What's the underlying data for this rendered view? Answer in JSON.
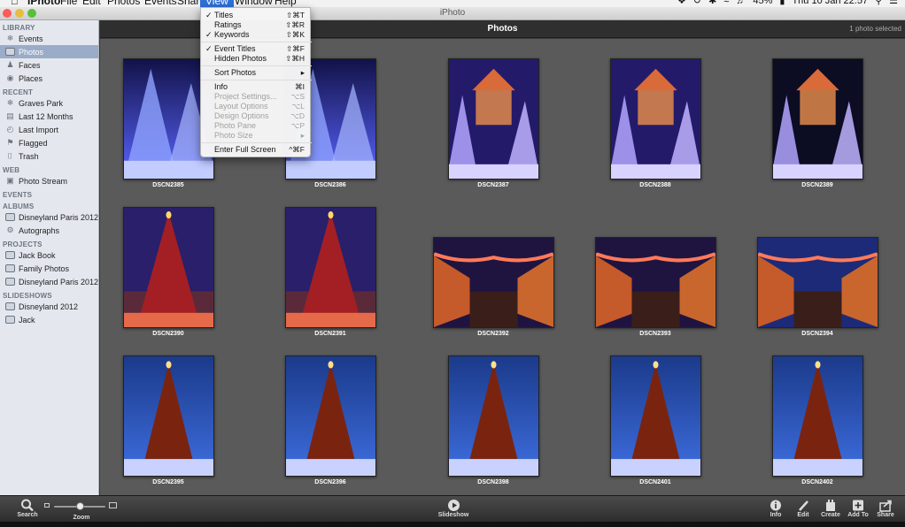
{
  "menubar": {
    "app": "iPhoto",
    "items": [
      "File",
      "Edit",
      "Photos",
      "Events",
      "Share",
      "View",
      "Window",
      "Help"
    ],
    "active": "View",
    "battery": "45%",
    "clock": "Thu 10 Jan  22:57"
  },
  "window": {
    "title": "iPhoto"
  },
  "sidebar": {
    "sections": [
      {
        "heading": "LIBRARY",
        "items": [
          {
            "label": "Events",
            "icon": "events-icon"
          },
          {
            "label": "Photos",
            "icon": "photos-icon",
            "selected": true
          },
          {
            "label": "Faces",
            "icon": "faces-icon"
          },
          {
            "label": "Places",
            "icon": "places-icon"
          }
        ]
      },
      {
        "heading": "RECENT",
        "items": [
          {
            "label": "Graves Park",
            "icon": "event-icon"
          },
          {
            "label": "Last 12 Months",
            "icon": "calendar-icon"
          },
          {
            "label": "Last Import",
            "icon": "clock-icon"
          },
          {
            "label": "Flagged",
            "icon": "flag-icon"
          },
          {
            "label": "Trash",
            "icon": "trash-icon"
          }
        ]
      },
      {
        "heading": "WEB",
        "items": [
          {
            "label": "Photo Stream",
            "icon": "photo-stream-icon"
          }
        ]
      },
      {
        "heading": "EVENTS",
        "items": []
      },
      {
        "heading": "ALBUMS",
        "items": [
          {
            "label": "Disneyland Paris 2012",
            "icon": "album-icon"
          },
          {
            "label": "Autographs",
            "icon": "smart-album-icon"
          }
        ]
      },
      {
        "heading": "PROJECTS",
        "items": [
          {
            "label": "Jack Book",
            "icon": "book-icon"
          },
          {
            "label": "Family Photos",
            "icon": "book-icon"
          },
          {
            "label": "Disneyland Paris 2012...",
            "icon": "book-icon"
          }
        ]
      },
      {
        "heading": "SLIDESHOWS",
        "items": [
          {
            "label": "Disneyland 2012",
            "icon": "slideshow-icon"
          },
          {
            "label": "Jack",
            "icon": "slideshow-icon"
          }
        ]
      }
    ]
  },
  "content": {
    "title": "Photos",
    "status": "1 photo selected"
  },
  "photos": [
    {
      "name": "DSCN2385",
      "kind": "trees-blue"
    },
    {
      "name": "DSCN2386",
      "kind": "trees-blue"
    },
    {
      "name": "DSCN2387",
      "kind": "gazebo-purple"
    },
    {
      "name": "DSCN2388",
      "kind": "gazebo-purple"
    },
    {
      "name": "DSCN2389",
      "kind": "gazebo-dark"
    },
    {
      "name": "DSCN2390",
      "kind": "tree-red"
    },
    {
      "name": "DSCN2391",
      "kind": "tree-red"
    },
    {
      "name": "DSCN2392",
      "kind": "street"
    },
    {
      "name": "DSCN2393",
      "kind": "street"
    },
    {
      "name": "DSCN2394",
      "kind": "street-blue"
    },
    {
      "name": "DSCN2395",
      "kind": "tree-blue"
    },
    {
      "name": "DSCN2396",
      "kind": "tree-blue"
    },
    {
      "name": "DSCN2398",
      "kind": "tree-blue"
    },
    {
      "name": "DSCN2401",
      "kind": "tree-blue"
    },
    {
      "name": "DSCN2402",
      "kind": "tree-blue"
    }
  ],
  "view_menu": [
    {
      "label": "Titles",
      "shortcut": "⇧⌘T",
      "checked": true
    },
    {
      "label": "Ratings",
      "shortcut": "⇧⌘R"
    },
    {
      "label": "Keywords",
      "shortcut": "⇧⌘K",
      "checked": true
    },
    {
      "separator": true
    },
    {
      "label": "Event Titles",
      "shortcut": "⇧⌘F",
      "checked": true
    },
    {
      "label": "Hidden Photos",
      "shortcut": "⇧⌘H"
    },
    {
      "separator": true
    },
    {
      "label": "Sort Photos",
      "submenu": true
    },
    {
      "separator": true
    },
    {
      "label": "Info",
      "shortcut": "⌘I"
    },
    {
      "label": "Project Settings...",
      "shortcut": "⌥S",
      "disabled": true
    },
    {
      "label": "Layout Options",
      "shortcut": "⌥L",
      "disabled": true
    },
    {
      "label": "Design Options",
      "shortcut": "⌥D",
      "disabled": true
    },
    {
      "label": "Photo Pane",
      "shortcut": "⌥P",
      "disabled": true
    },
    {
      "label": "Photo Size",
      "submenu": true,
      "disabled": true
    },
    {
      "separator": true
    },
    {
      "label": "Enter Full Screen",
      "shortcut": "^⌘F"
    }
  ],
  "toolbar": {
    "search": "Search",
    "zoom": "Zoom",
    "slideshow": "Slideshow",
    "info": "Info",
    "edit": "Edit",
    "create": "Create",
    "add_to": "Add To",
    "share": "Share"
  },
  "colors": {
    "selection": "#9aacc7",
    "menu_highlight": "#2f6fd6",
    "grid_bg": "#5a5a5a"
  }
}
